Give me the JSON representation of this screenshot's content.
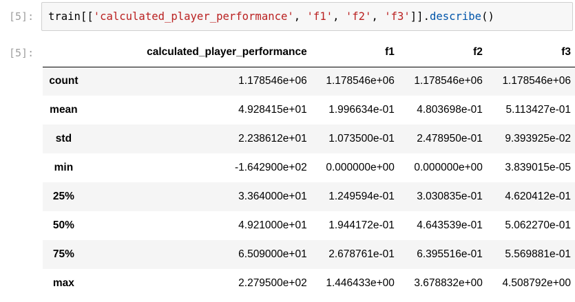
{
  "input_cell": {
    "prompt": "[5]:",
    "code": {
      "t1": "train[[",
      "s1": "'calculated_player_performance'",
      "c1": ", ",
      "s2": "'f1'",
      "c2": ", ",
      "s3": "'f2'",
      "c3": ", ",
      "s4": "'f3'",
      "t2": "]].",
      "method": "describe",
      "t3": "()"
    }
  },
  "output_cell": {
    "prompt": "[5]:",
    "table": {
      "columns": [
        "",
        "calculated_player_performance",
        "f1",
        "f2",
        "f3"
      ],
      "rows": [
        {
          "index": "count",
          "values": [
            "1.178546e+06",
            "1.178546e+06",
            "1.178546e+06",
            "1.178546e+06"
          ]
        },
        {
          "index": "mean",
          "values": [
            "4.928415e+01",
            "1.996634e-01",
            "4.803698e-01",
            "5.113427e-01"
          ]
        },
        {
          "index": "std",
          "values": [
            "2.238612e+01",
            "1.073500e-01",
            "2.478950e-01",
            "9.393925e-02"
          ]
        },
        {
          "index": "min",
          "values": [
            "-1.642900e+02",
            "0.000000e+00",
            "0.000000e+00",
            "3.839015e-05"
          ]
        },
        {
          "index": "25%",
          "values": [
            "3.364000e+01",
            "1.249594e-01",
            "3.030835e-01",
            "4.620412e-01"
          ]
        },
        {
          "index": "50%",
          "values": [
            "4.921000e+01",
            "1.944172e-01",
            "4.643539e-01",
            "5.062270e-01"
          ]
        },
        {
          "index": "75%",
          "values": [
            "6.509000e+01",
            "2.678761e-01",
            "6.395516e-01",
            "5.569881e-01"
          ]
        },
        {
          "index": "max",
          "values": [
            "2.279500e+02",
            "1.446433e+00",
            "3.678832e+00",
            "4.508792e+00"
          ]
        }
      ]
    }
  },
  "colors": {
    "prompt": "#9e9e9e",
    "string": "#ba2121",
    "method": "#0055aa",
    "code_background": "#f7f7f7",
    "stripe": "#f5f5f5"
  }
}
